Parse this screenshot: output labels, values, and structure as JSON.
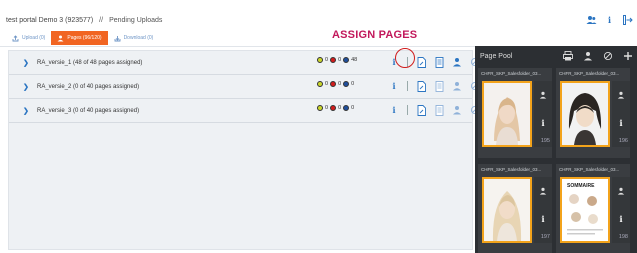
{
  "breadcrumb": {
    "portal": "test portal Demo 3 (923577)",
    "separator": "//",
    "section": "Pending Uploads"
  },
  "tabs": [
    {
      "label": "Upload (0)",
      "active": false
    },
    {
      "label": "Pages (96/120)",
      "active": true
    },
    {
      "label": "Download (0)",
      "active": false
    }
  ],
  "annotation": {
    "heading": "ASSIGN PAGES",
    "color": "#c2185b"
  },
  "colors": {
    "accent": "#f16522",
    "link": "#2b75c2",
    "pool_bg": "#2c2f33",
    "thumb_border": "#f3a31b",
    "highlight": "#d01c1c"
  },
  "versions": [
    {
      "label": "RA_versie_1 (48 of 48 pages assigned)",
      "c1": "0",
      "c2": "0",
      "c3": "48"
    },
    {
      "label": "RA_versie_2 (0 of 40 pages assigned)",
      "c1": "0",
      "c2": "0",
      "c3": "0"
    },
    {
      "label": "RA_versie_3 (0 of 40 pages assigned)",
      "c1": "0",
      "c2": "0",
      "c3": "0"
    }
  ],
  "page_pool": {
    "title": "Page Pool",
    "cards": [
      {
        "name": "CHFR_SKP_Salesfolder_03...",
        "page": "195"
      },
      {
        "name": "CHFR_SKP_Salesfolder_03...",
        "page": "196"
      },
      {
        "name": "CHFR_SKP_Salesfolder_03...",
        "page": "197"
      },
      {
        "name": "CHFR_SKP_Salesfolder_03...",
        "page": "198",
        "thumb_text": "SOMMAIRE"
      }
    ]
  },
  "icons": [
    "user-icon",
    "info-icon",
    "logout-icon",
    "upload-icon",
    "pages-icon",
    "download-icon",
    "chevron-right-icon",
    "assign-pages-icon",
    "document-icon",
    "user-assign-icon",
    "cancel-icon",
    "print-icon",
    "pin-icon"
  ]
}
